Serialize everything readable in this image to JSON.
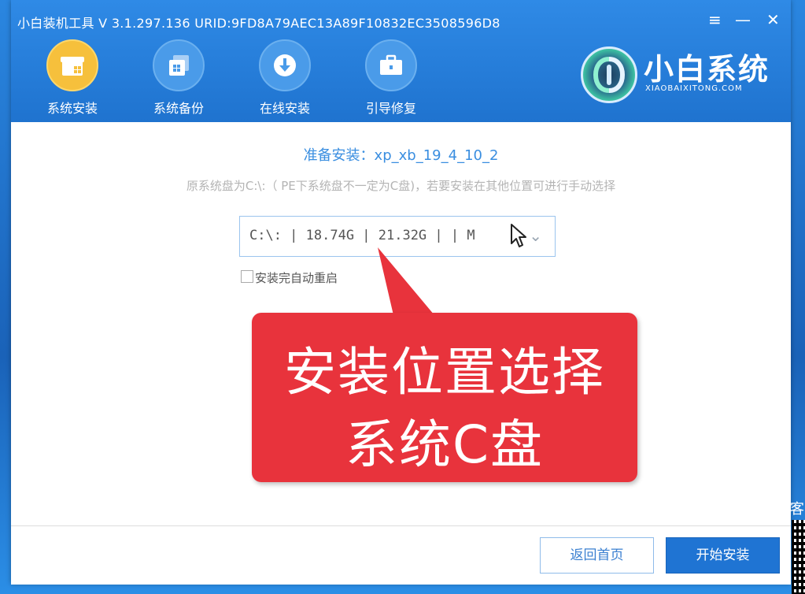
{
  "window": {
    "title": "小白装机工具 V 3.1.297.136 URID:9FD8A79AEC13A89F10832EC3508596D8"
  },
  "window_controls": {
    "menu_glyph": "≡",
    "minimize_glyph": "—",
    "close_glyph": "✕"
  },
  "nav": {
    "items": [
      {
        "label": "系统安装",
        "icon": "install-box-icon",
        "active": true
      },
      {
        "label": "系统备份",
        "icon": "backup-icon",
        "active": false
      },
      {
        "label": "在线安装",
        "icon": "download-icon",
        "active": false
      },
      {
        "label": "引导修复",
        "icon": "toolbox-icon",
        "active": false
      }
    ]
  },
  "logo": {
    "name": "小白系统",
    "subtitle": "XIAOBAIXITONG.COM"
  },
  "content": {
    "prep_title": "准备安装：xp_xb_19_4_10_2",
    "prep_hint": "原系统盘为C:\\:（ PE下系统盘不一定为C盘)，若要安装在其他位置可进行手动选择",
    "partition_value": "C:\\: | 18.74G | 21.32G |   | M",
    "auto_restart_label": "安装完自动重启",
    "auto_restart_checked": false
  },
  "callout": {
    "line1": "安装位置选择",
    "line2": "系统C盘"
  },
  "footer": {
    "back_label": "返回首页",
    "start_label": "开始安装"
  },
  "side": {
    "text": "客"
  },
  "colors": {
    "brand_blue": "#1f74d3",
    "active_nav": "#f6c03c",
    "callout_red": "#e8333c",
    "title_blue": "#3a8ee0"
  }
}
